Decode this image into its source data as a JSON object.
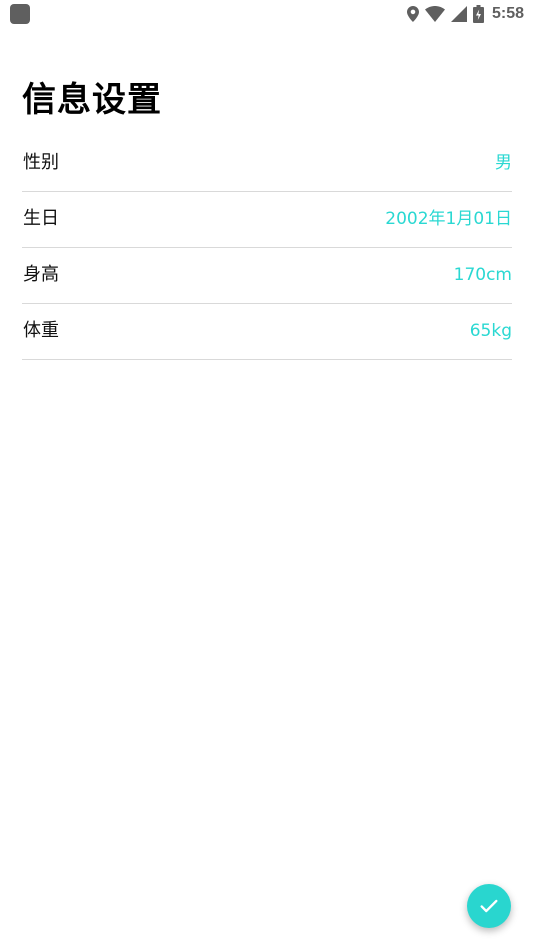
{
  "status_bar": {
    "time": "5:58",
    "icons": [
      "app-icon",
      "location-icon",
      "wifi-icon",
      "cellular-signal-icon",
      "battery-icon"
    ]
  },
  "page": {
    "title": "信息设置"
  },
  "settings": [
    {
      "label": "性别",
      "value": "男"
    },
    {
      "label": "生日",
      "value": "2002年1月01日"
    },
    {
      "label": "身高",
      "value": "170cm"
    },
    {
      "label": "体重",
      "value": "65kg"
    }
  ],
  "fab": {
    "icon": "check-icon"
  },
  "colors": {
    "accent": "#2ad8d2",
    "divider": "#d9d9d9",
    "status_icons": "#5f5f5f"
  }
}
